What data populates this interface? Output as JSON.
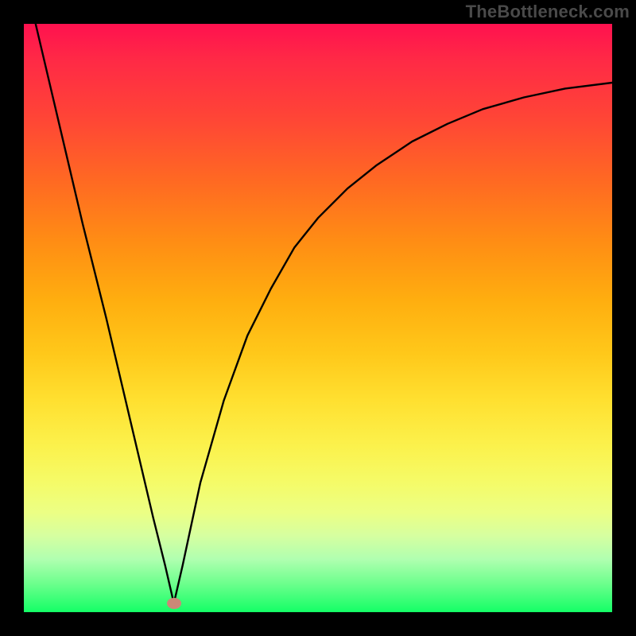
{
  "watermark": "TheBottleneck.com",
  "chart_data": {
    "type": "line",
    "title": "",
    "xlabel": "",
    "ylabel": "",
    "xlim": [
      0,
      100
    ],
    "ylim": [
      0,
      100
    ],
    "grid": false,
    "series": [
      {
        "name": "curve",
        "x": [
          2,
          6,
          10,
          14,
          18,
          22,
          24,
          25.5,
          27,
          30,
          34,
          38,
          42,
          46,
          50,
          55,
          60,
          66,
          72,
          78,
          85,
          92,
          100
        ],
        "y": [
          100,
          83,
          66,
          50,
          33,
          16,
          8,
          1.5,
          8,
          22,
          36,
          47,
          55,
          62,
          67,
          72,
          76,
          80,
          83,
          85.5,
          87.5,
          89,
          90
        ]
      }
    ],
    "marker": {
      "x": 25.5,
      "y": 1.5
    },
    "colors": {
      "curve_stroke": "#000000",
      "marker_fill": "#cc8777",
      "gradient_top": "#ff114f",
      "gradient_bottom": "#14ff66"
    }
  }
}
